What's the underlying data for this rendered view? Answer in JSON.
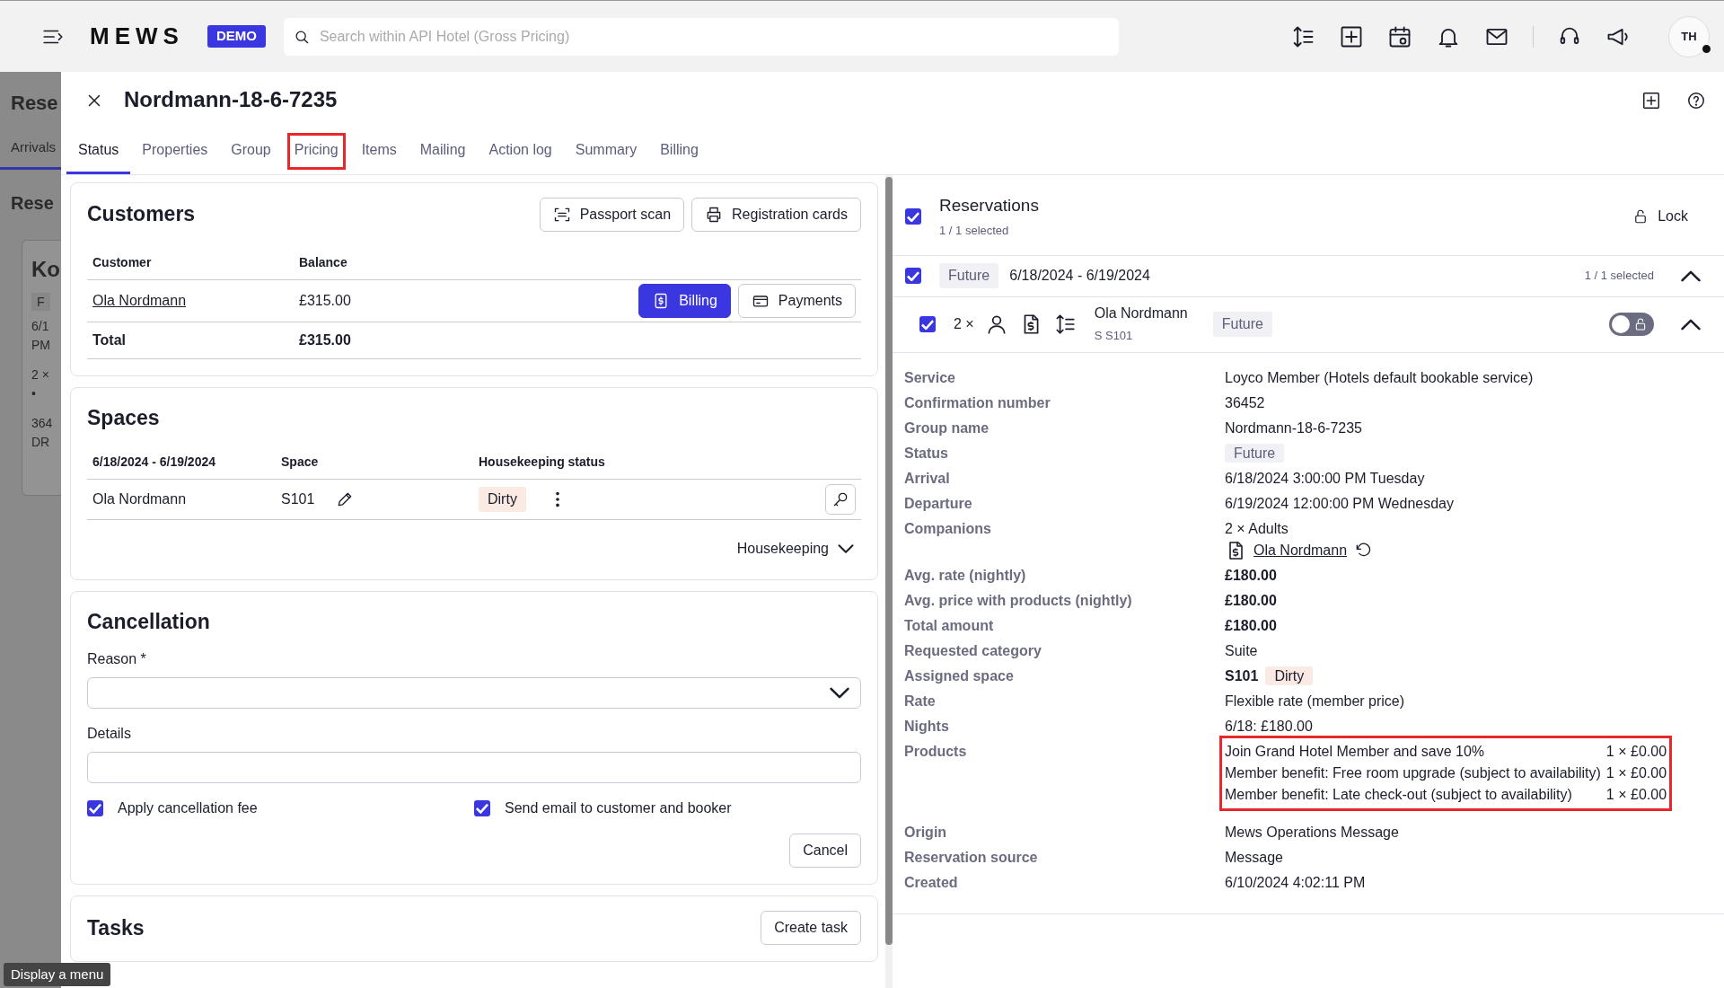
{
  "top_bar": {
    "logo": "MEWS",
    "badge": "DEMO",
    "search": {
      "placeholder": "Search within API Hotel (Gross Pricing)"
    },
    "avatar": "TH"
  },
  "background_page": {
    "title": "Rese",
    "tab": "Arrivals",
    "section": "Rese",
    "card": {
      "title": "Ko",
      "tag": "F",
      "lines": [
        "6/1",
        "PM",
        "2 ×",
        "•",
        "364",
        "DR"
      ]
    }
  },
  "panel": {
    "title": "Nordmann-18-6-7235",
    "tabs": [
      {
        "label": "Status",
        "selected": true,
        "highlighted": false
      },
      {
        "label": "Properties",
        "selected": false,
        "highlighted": false
      },
      {
        "label": "Group",
        "selected": false,
        "highlighted": false
      },
      {
        "label": "Pricing",
        "selected": false,
        "highlighted": true
      },
      {
        "label": "Items",
        "selected": false,
        "highlighted": false
      },
      {
        "label": "Mailing",
        "selected": false,
        "highlighted": false
      },
      {
        "label": "Action log",
        "selected": false,
        "highlighted": false
      },
      {
        "label": "Summary",
        "selected": false,
        "highlighted": false
      },
      {
        "label": "Billing",
        "selected": false,
        "highlighted": false
      }
    ]
  },
  "customers": {
    "title": "Customers",
    "buttons": [
      {
        "label": "Passport scan",
        "kind": "scan"
      },
      {
        "label": "Registration cards",
        "kind": "print"
      }
    ],
    "columns": [
      "Customer",
      "Balance"
    ],
    "rows": [
      {
        "name": "Ola Nordmann",
        "balance": "£315.00",
        "actions": [
          {
            "label": "Billing",
            "primary": true,
            "kind": "bill"
          },
          {
            "label": "Payments",
            "primary": false,
            "kind": "card"
          }
        ]
      }
    ],
    "total": {
      "label": "Total",
      "balance": "£315.00"
    }
  },
  "spaces": {
    "title": "Spaces",
    "columns": [
      "6/18/2024 - 6/19/2024",
      "Space",
      "Housekeeping status"
    ],
    "rows": [
      {
        "name": "Ola Nordmann",
        "space": "S101",
        "status": "Dirty"
      }
    ],
    "toggle": "Housekeeping"
  },
  "cancellation": {
    "title": "Cancellation",
    "reason": {
      "label": "Reason *"
    },
    "details": {
      "label": "Details"
    },
    "checkboxes": [
      {
        "label": "Apply cancellation fee",
        "checked": true
      },
      {
        "label": "Send email to customer and booker",
        "checked": true
      }
    ],
    "button": "Cancel"
  },
  "tasks": {
    "title": "Tasks",
    "button": "Create task"
  },
  "reservations": {
    "title": "Reservations",
    "selected_count": "1 / 1 selected",
    "checked": true,
    "lock": "Lock",
    "groups": [
      {
        "checked": true,
        "status": "Future",
        "dates": "6/18/2024 - 6/19/2024",
        "selected_count": "1 / 1 selected",
        "expanded": true,
        "reservations": [
          {
            "checked": true,
            "count": "2 ×",
            "name": "Ola Nordmann",
            "space": "S S101",
            "status": "Future",
            "lock_on": false,
            "expanded": true
          }
        ]
      }
    ]
  },
  "details": [
    {
      "label": "Service",
      "kind": "text",
      "value": "Loyco Member (Hotels default bookable service)"
    },
    {
      "label": "Confirmation number",
      "kind": "text",
      "value": "36452"
    },
    {
      "label": "Group name",
      "kind": "text",
      "value": "Nordmann-18-6-7235"
    },
    {
      "label": "Status",
      "kind": "tag",
      "value": "Future"
    },
    {
      "label": "Arrival",
      "kind": "text",
      "value": "6/18/2024 3:00:00 PM Tuesday"
    },
    {
      "label": "Departure",
      "kind": "text",
      "value": "6/19/2024 12:00:00 PM Wednesday"
    },
    {
      "label": "Companions",
      "kind": "companions",
      "value": "2 × Adults",
      "person": "Ola Nordmann"
    },
    {
      "label": "Avg. rate (nightly)",
      "kind": "bold",
      "value": "£180.00"
    },
    {
      "label": "Avg. price with products (nightly)",
      "kind": "bold",
      "value": "£180.00"
    },
    {
      "label": "Total amount",
      "kind": "bold",
      "value": "£180.00"
    },
    {
      "label": "Requested category",
      "kind": "text",
      "value": "Suite"
    },
    {
      "label": "Assigned space",
      "kind": "space",
      "value": "S101",
      "status": "Dirty"
    },
    {
      "label": "Rate",
      "kind": "text",
      "value": "Flexible rate (member price)"
    },
    {
      "label": "Nights",
      "kind": "text",
      "value": "6/18: £180.00"
    },
    {
      "label": "Products",
      "kind": "products",
      "highlighted": true,
      "items": [
        {
          "name": "Join Grand Hotel Member and save 10%",
          "amount": "1 × £0.00"
        },
        {
          "name": "Member benefit: Free room upgrade (subject to availability)",
          "amount": "1 × £0.00"
        },
        {
          "name": "Member benefit: Late check-out (subject to availability)",
          "amount": "1 × £0.00"
        }
      ]
    },
    {
      "label": "Origin",
      "kind": "text",
      "value": "Mews Operations Message"
    },
    {
      "label": "Reservation source",
      "kind": "text",
      "value": "Message"
    },
    {
      "label": "Created",
      "kind": "text",
      "value": "6/10/2024 4:02:11 PM"
    }
  ],
  "tooltip": "Display a menu"
}
